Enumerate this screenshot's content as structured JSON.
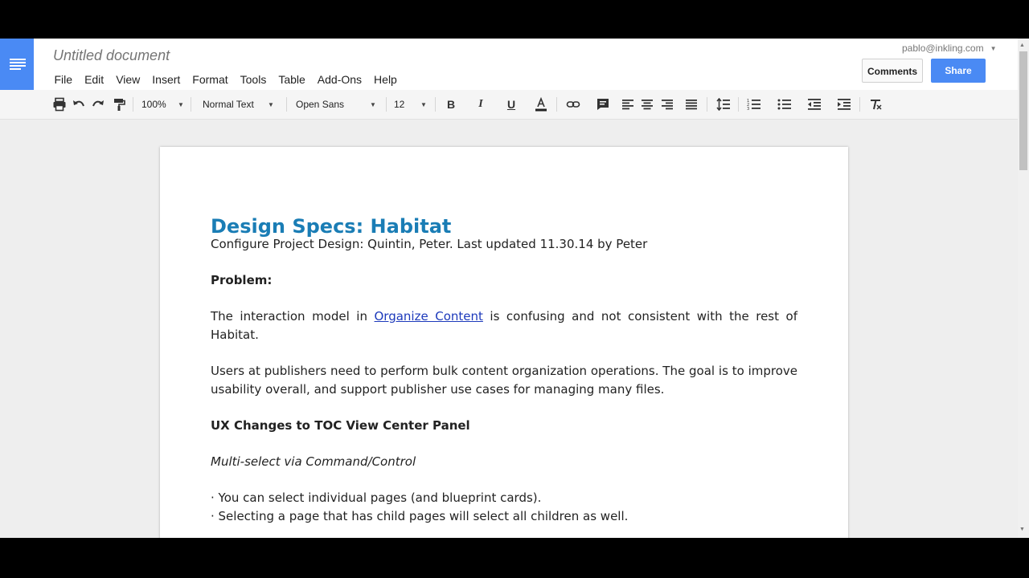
{
  "header": {
    "title": "Untitled document",
    "menus": [
      "File",
      "Edit",
      "View",
      "Insert",
      "Format",
      "Tools",
      "Table",
      "Add-Ons",
      "Help"
    ],
    "account": "pablo@inkling.com",
    "comments_label": "Comments",
    "share_label": "Share",
    "share_color": "#4a8af4"
  },
  "toolbar": {
    "zoom": "100%",
    "style": "Normal Text",
    "font": "Open Sans",
    "size": "12",
    "icons": [
      "print-icon",
      "undo-icon",
      "redo-icon",
      "paint-format-icon",
      "bold-icon",
      "italic-icon",
      "underline-icon",
      "text-color-icon",
      "link-icon",
      "comment-icon",
      "align-left-icon",
      "align-center-icon",
      "align-right-icon",
      "align-justify-icon",
      "line-spacing-icon",
      "numbered-list-icon",
      "bulleted-list-icon",
      "decrease-indent-icon",
      "increase-indent-icon",
      "clear-formatting-icon"
    ]
  },
  "document": {
    "heading": "Design Specs: Habitat",
    "heading_color": "#1a7db5",
    "subtitle": "Configure Project Design: Quintin, Peter. Last updated 11.30.14 by Peter",
    "problem_label": "Problem:",
    "para1_before": "The interaction model in ",
    "para1_link": "Organize Content",
    "para1_after": " is confusing and not consistent with the rest of Habitat.",
    "para2": "Users at publishers need to perform bulk content organization operations. The goal is to improve usability overall, and support publisher use cases for managing many files.",
    "section_heading": "UX Changes to TOC View Center Panel",
    "subsection": "Multi-select via Command/Control",
    "bullets": [
      "· You can select individual pages (and blueprint cards).",
      "· Selecting a page that has child pages will select all children as well."
    ]
  }
}
